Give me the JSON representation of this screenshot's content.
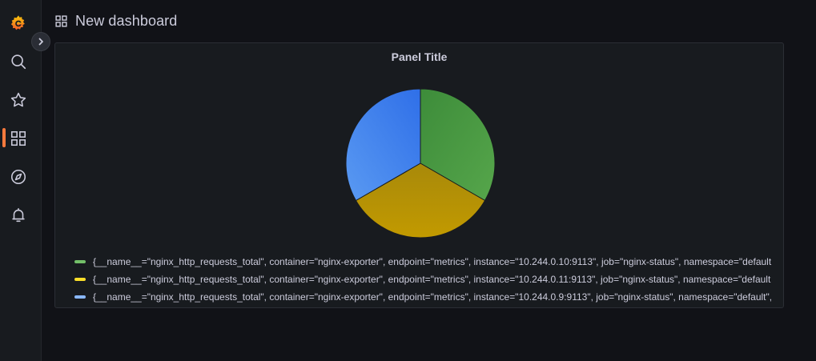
{
  "header": {
    "title": "New dashboard",
    "icon": "dashboard-grid-icon"
  },
  "sidebar": {
    "items": [
      {
        "name": "grafana-logo-icon",
        "active": false
      },
      {
        "name": "search-icon",
        "active": false
      },
      {
        "name": "star-icon",
        "active": false
      },
      {
        "name": "dashboards-icon",
        "active": true
      },
      {
        "name": "explore-compass-icon",
        "active": false
      },
      {
        "name": "alerting-bell-icon",
        "active": false
      }
    ],
    "expand_icon": "chevron-right-icon"
  },
  "colors": {
    "accent": "#ff7a3d",
    "series_green": "#56a64b",
    "series_yellow": "#e0b400",
    "series_blue": "#5794f2"
  },
  "panel": {
    "title": "Panel Title",
    "legend": [
      {
        "label": "{__name__=\"nginx_http_requests_total\", container=\"nginx-exporter\", endpoint=\"metrics\", instance=\"10.244.0.10:9113\", job=\"nginx-status\", namespace=\"default",
        "color": "#73bf69"
      },
      {
        "label": "{__name__=\"nginx_http_requests_total\", container=\"nginx-exporter\", endpoint=\"metrics\", instance=\"10.244.0.11:9113\", job=\"nginx-status\", namespace=\"default",
        "color": "#fade2a"
      },
      {
        "label": "{__name__=\"nginx_http_requests_total\", container=\"nginx-exporter\", endpoint=\"metrics\", instance=\"10.244.0.9:9113\", job=\"nginx-status\", namespace=\"default\",",
        "color": "#8ab8ff"
      }
    ]
  },
  "chart_data": {
    "type": "pie",
    "title": "Panel Title",
    "series": [
      {
        "name": "{__name__=\"nginx_http_requests_total\", container=\"nginx-exporter\", endpoint=\"metrics\", instance=\"10.244.0.10:9113\", job=\"nginx-status\", namespace=\"default",
        "value": 1,
        "color": "#56a64b"
      },
      {
        "name": "{__name__=\"nginx_http_requests_total\", container=\"nginx-exporter\", endpoint=\"metrics\", instance=\"10.244.0.11:9113\", job=\"nginx-status\", namespace=\"default",
        "value": 1,
        "color": "#e0b400"
      },
      {
        "name": "{__name__=\"nginx_http_requests_total\", container=\"nginx-exporter\", endpoint=\"metrics\", instance=\"10.244.0.9:9113\", job=\"nginx-status\", namespace=\"default\",",
        "value": 1,
        "color": "#5794f2"
      }
    ],
    "legend_placement": "bottom"
  }
}
